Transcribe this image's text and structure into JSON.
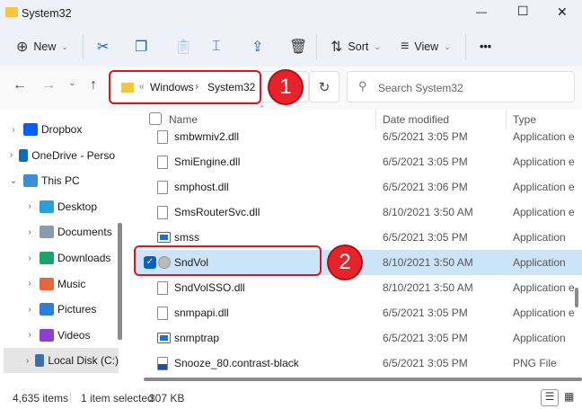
{
  "window": {
    "title": "System32",
    "minimize": "—",
    "maximize": "☐",
    "close": "✕"
  },
  "toolbar": {
    "new": "New",
    "sort": "Sort",
    "view": "View",
    "more": "•••"
  },
  "nav": {
    "breadcrumb": [
      "«",
      "Windows",
      "System32"
    ],
    "search_placeholder": "Search System32"
  },
  "annotations": [
    "1",
    "2"
  ],
  "sidebar": {
    "items": [
      {
        "label": "Dropbox",
        "color": "#0061fe",
        "chev": "›"
      },
      {
        "label": "OneDrive - Perso",
        "color": "#0f6cbd",
        "chev": "›"
      },
      {
        "label": "This PC",
        "color": "#3a8fd8",
        "chev": "⌄"
      },
      {
        "label": "Desktop",
        "color": "#2aa0d8",
        "chev": "›"
      },
      {
        "label": "Documents",
        "color": "#8a9bb0",
        "chev": "›"
      },
      {
        "label": "Downloads",
        "color": "#1aa36b",
        "chev": "›"
      },
      {
        "label": "Music",
        "color": "#e8643c",
        "chev": "›"
      },
      {
        "label": "Pictures",
        "color": "#2a7fd8",
        "chev": "›"
      },
      {
        "label": "Videos",
        "color": "#8b3fd0",
        "chev": "›"
      },
      {
        "label": "Local Disk (C:)",
        "color": "#3a6fb0",
        "chev": "›"
      }
    ]
  },
  "columns": {
    "name": "Name",
    "date": "Date modified",
    "type": "Type"
  },
  "files": [
    {
      "name": "smbwmiv2.dll",
      "date": "6/5/2021 3:05 PM",
      "type": "Application e"
    },
    {
      "name": "SmiEngine.dll",
      "date": "6/5/2021 3:05 PM",
      "type": "Application e"
    },
    {
      "name": "smphost.dll",
      "date": "6/5/2021 3:06 PM",
      "type": "Application e"
    },
    {
      "name": "SmsRouterSvc.dll",
      "date": "8/10/2021 3:50 AM",
      "type": "Application e"
    },
    {
      "name": "smss",
      "date": "6/5/2021 3:05 PM",
      "type": "Application"
    },
    {
      "name": "SndVol",
      "date": "8/10/2021 3:50 AM",
      "type": "Application"
    },
    {
      "name": "SndVolSSO.dll",
      "date": "8/10/2021 3:50 AM",
      "type": "Application e"
    },
    {
      "name": "snmpapi.dll",
      "date": "6/5/2021 3:05 PM",
      "type": "Application e"
    },
    {
      "name": "snmptrap",
      "date": "6/5/2021 3:05 PM",
      "type": "Application"
    },
    {
      "name": "Snooze_80.contrast-black",
      "date": "6/5/2021 3:05 PM",
      "type": "PNG File"
    }
  ],
  "status": {
    "count": "4,635 items",
    "selected": "1 item selected",
    "size": "307 KB"
  }
}
